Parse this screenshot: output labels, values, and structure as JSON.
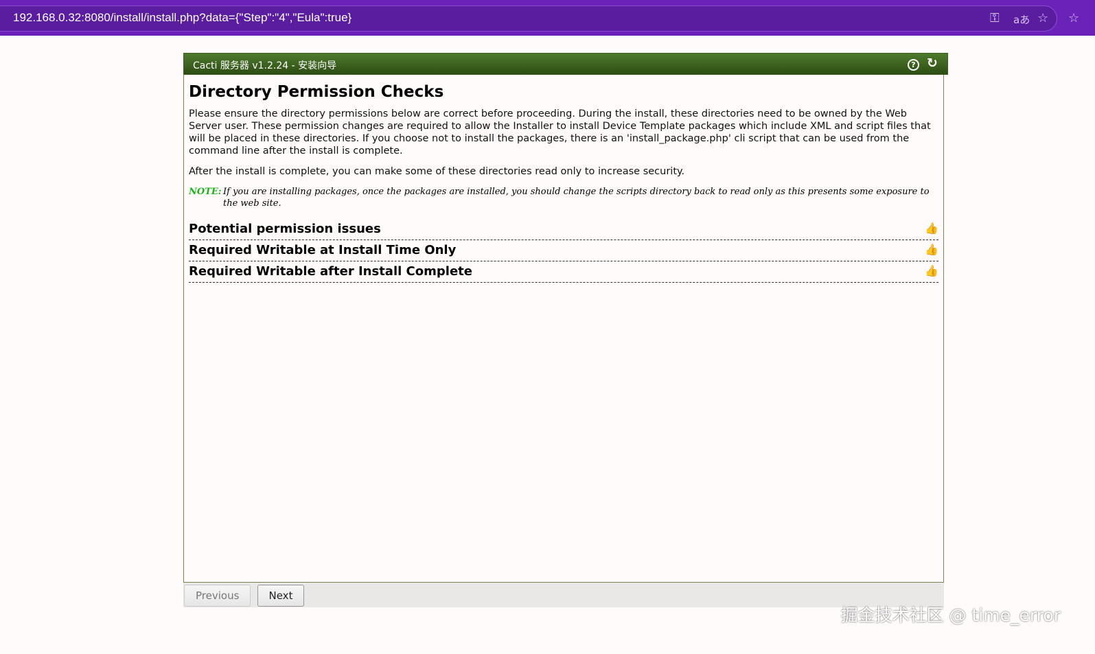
{
  "browser": {
    "url": "192.168.0.32:8080/install/install.php?data={\"Step\":\"4\",\"Eula\":true}"
  },
  "header": {
    "title": "Cacti 服务器 v1.2.24 - 安装向导"
  },
  "main": {
    "title": "Directory Permission Checks",
    "para1": "Please ensure the directory permissions below are correct before proceeding. During the install, these directories need to be owned by the Web Server user. These permission changes are required to allow the Installer to install Device Template packages which include XML and script files that will be placed in these directories. If you choose not to install the packages, there is an 'install_package.php' cli script that can be used from the command line after the install is complete.",
    "para2": "After the install is complete, you can make some of these directories read only to increase security.",
    "note_label": "NOTE:",
    "note_text": "If you are installing packages, once the packages are installed, you should change the scripts directory back to read only as this presents some exposure to the web site.",
    "sections": [
      {
        "label": "Potential permission issues"
      },
      {
        "label": "Required Writable at Install Time Only"
      },
      {
        "label": "Required Writable after Install Complete"
      }
    ]
  },
  "footer": {
    "previous": "Previous",
    "next": "Next"
  },
  "watermark": "掘金技术社区 @ time_error"
}
